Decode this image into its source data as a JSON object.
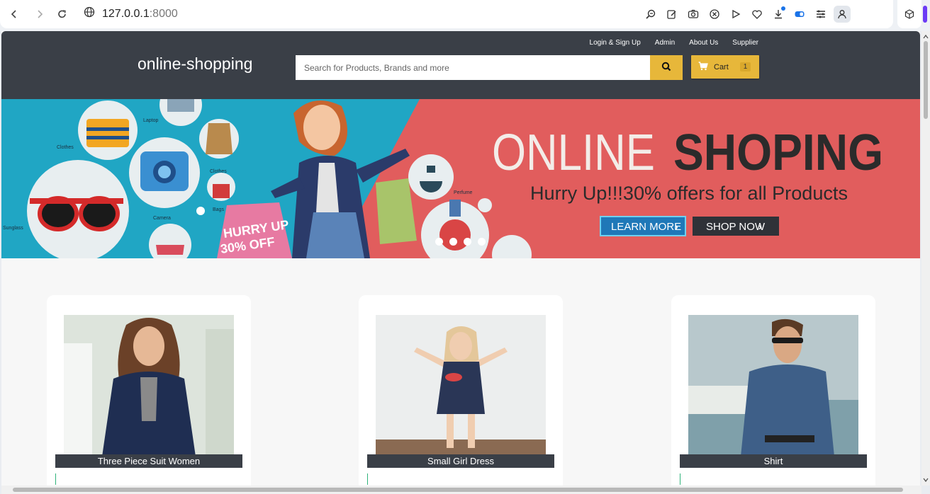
{
  "browser": {
    "url_host": "127.0.0.1",
    "url_port": ":8000",
    "icons": [
      "back-icon",
      "forward-icon",
      "reload-icon",
      "site-info-icon",
      "zoom-icon",
      "edit-icon",
      "camera-icon",
      "shield-icon",
      "play-icon",
      "heart-icon",
      "download-icon",
      "toggle-icon",
      "menu-icon",
      "profile-icon",
      "cube-icon"
    ]
  },
  "header": {
    "brand": "online-shopping",
    "links": [
      "Login & Sign Up",
      "Admin",
      "About Us",
      "Supplier"
    ],
    "search_placeholder": "Search for Products, Brands and more",
    "cart_label": "Cart",
    "cart_count": "1",
    "colors": {
      "header_bg": "#3a3f47",
      "accent": "#e7b73a"
    }
  },
  "banner": {
    "headline_light": "ONLINE",
    "headline_bold": "SHOPING",
    "subline": "Hurry Up!!!30% offers for all Products",
    "btn_learn": "LEARN MORE",
    "btn_shop": "SHOP NOW",
    "bag_line1": "HURRY UP",
    "bag_line2": "30% OFF",
    "icon_labels": [
      "Clothes",
      "Laptop",
      "Clothes",
      "Camera",
      "Bags",
      "Sunglass",
      "Perfume"
    ],
    "slide_count": 4
  },
  "products": [
    {
      "name": "Three Piece Suit Women"
    },
    {
      "name": "Small Girl Dress"
    },
    {
      "name": "Shirt"
    }
  ]
}
